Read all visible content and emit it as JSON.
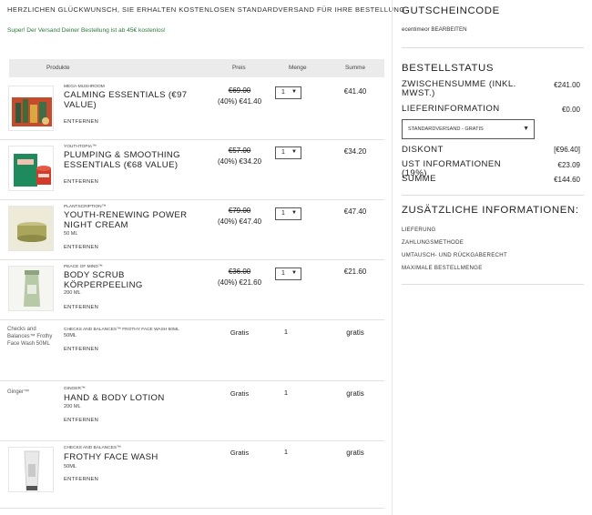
{
  "banner": {
    "promo": "HERZLICHEN GLÜCKWUNSCH, SIE ERHALTEN KOSTENLOSEN STANDARDVERSAND FÜR IHRE BESTELLUNG",
    "sub": "Super! Der Versand Deiner Bestellung ist ab 45€ kostenlos!"
  },
  "table": {
    "headers": {
      "product": "Produkte",
      "price": "Preis",
      "qty": "Menge",
      "total": "Summe"
    }
  },
  "items": [
    {
      "brand": "MEGA-MUSHROOM",
      "name": "CALMING ESSENTIALS (€97 VALUE)",
      "size": "",
      "remove": "ENTFERNEN",
      "old_price": "€69.00",
      "discount_price": "(40%) €41.40",
      "qty": "1",
      "total": "€41.40"
    },
    {
      "brand": "YOUTHTOPIA™",
      "name": "PLUMPING & SMOOTHING ESSENTIALS (€68 VALUE)",
      "size": "",
      "remove": "ENTFERNEN",
      "old_price": "€57.00",
      "discount_price": "(40%) €34.20",
      "qty": "1",
      "total": "€34.20"
    },
    {
      "brand": "PLANTSCRIPTION™",
      "name": "YOUTH-RENEWING POWER NIGHT CREAM",
      "size": "50 ML",
      "remove": "ENTFERNEN",
      "old_price": "€79.00",
      "discount_price": "(40%) €47.40",
      "qty": "1",
      "total": "€47.40"
    },
    {
      "brand": "PEACE OF MIND™",
      "name": "BODY SCRUB KÖRPERPEELING",
      "size": "200 ML",
      "remove": "ENTFERNEN",
      "old_price": "€36.00",
      "discount_price": "(40%) €21.60",
      "qty": "1",
      "total": "€21.60"
    },
    {
      "alt": "Checks and Balances™ Frothy Face Wash 50ML",
      "brand": "CHECKS AND BALANCES™ FROTHY FACE WASH 50ML",
      "name": "",
      "size": "50ML",
      "remove": "ENTFERNEN",
      "price": "Gratis",
      "qty": "1",
      "total": "gratis"
    },
    {
      "alt": "Ginger™",
      "brand": "GINGER™",
      "name": "HAND & BODY LOTION",
      "size": "200 ML",
      "remove": "ENTFERNEN",
      "price": "Gratis",
      "qty": "1",
      "total": "gratis"
    },
    {
      "brand": "CHECKS AND BALANCES™",
      "name": "FROTHY FACE WASH",
      "size": "50ML",
      "remove": "ENTFERNEN",
      "price": "Gratis",
      "qty": "1",
      "total": "gratis"
    }
  ],
  "sidebar": {
    "voucher_title": "GUTSCHEINCODE",
    "voucher_code": "ecentimeor",
    "voucher_edit": "BEARBEITEN",
    "status_title": "BESTELLSTATUS",
    "subtotal_label": "ZWISCHENSUMME (INKL. MWST.)",
    "subtotal_value": "€241.00",
    "shipping_label": "LIEFERINFORMATION",
    "shipping_value": "€0.00",
    "shipping_option": "STANDARDVERSAND - GRATIS",
    "discount_label": "DISKONT",
    "discount_value": "[€96.40]",
    "tax_label": "UST INFORMATIONEN (19%)",
    "tax_value": "€23.09",
    "sum_label": "SUMME",
    "sum_value": "€144.60",
    "info_title": "ZUSÄTZLICHE INFORMATIONEN:",
    "info_links": [
      "LIEFERUNG",
      "ZAHLUNGSMETHODE",
      "UMTAUSCH- UND RÜCKGABERECHT",
      "MAXIMALE BESTELLMENGE"
    ]
  }
}
